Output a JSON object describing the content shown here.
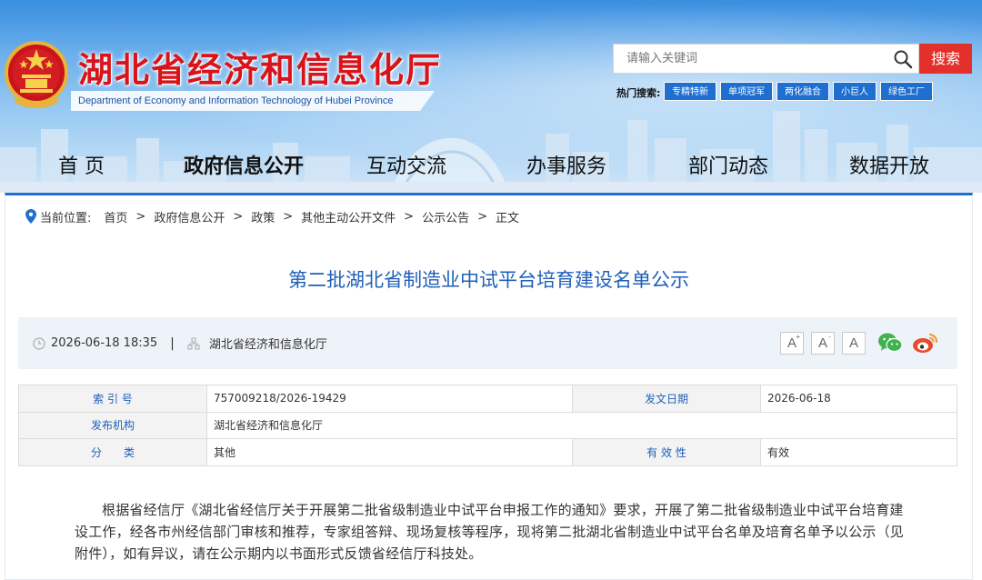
{
  "header": {
    "site_title": "湖北省经济和信息化厅",
    "site_subtitle": "Department of Economy and Information Technology of Hubei Province",
    "search": {
      "placeholder": "请输入关键词",
      "button_label": "搜索"
    },
    "hot_search": {
      "label": "热门搜索:",
      "tags": [
        "专精特新",
        "单项冠军",
        "两化融合",
        "小巨人",
        "绿色工厂"
      ]
    }
  },
  "nav": {
    "items": [
      "首 页",
      "政府信息公开",
      "互动交流",
      "办事服务",
      "部门动态",
      "数据开放"
    ],
    "active_index": 1
  },
  "breadcrumb": {
    "prefix": "当前位置:",
    "items": [
      "首页",
      "政府信息公开",
      "政策",
      "其他主动公开文件",
      "公示公告",
      "正文"
    ],
    "separator": ">"
  },
  "article": {
    "title": "第二批湖北省制造业中试平台培育建设名单公示",
    "date": "2026-06-18 18:35",
    "source": "湖北省经济和信息化厅",
    "meta_divider": "|",
    "font_sizes": [
      "A",
      "A",
      "A"
    ],
    "info": {
      "index_label": "索 引 号",
      "index_value": "757009218/2026-19429",
      "date_label": "发文日期",
      "date_value": "2026-06-18",
      "org_label": "发布机构",
      "org_value": "湖北省经济和信息化厅",
      "category_label": "分　　类",
      "category_value": "其他",
      "validity_label": "有 效 性",
      "validity_value": "有效"
    },
    "body": "根据省经信厅《湖北省经信厅关于开展第二批省级制造业中试平台申报工作的通知》要求，开展了第二批省级制造业中试平台培育建设工作，经各市州经信部门审核和推荐，专家组答辩、现场复核等程序，现将第二批湖北省制造业中试平台名单及培育名单予以公示（见附件），如有异议，请在公示期内以书面形式反馈省经信厅科技处。"
  },
  "colors": {
    "brand_red": "#d8141a",
    "nav_blue": "#1e6fcf",
    "title_blue": "#1f5fb8",
    "search_red": "#e4302b",
    "tag_blue": "#1f6fd0",
    "meta_bg": "#eef3fa"
  },
  "icons": [
    "national-emblem-icon",
    "search-icon",
    "location-pin-icon",
    "clock-icon",
    "organization-icon",
    "wechat-icon",
    "weibo-icon"
  ]
}
